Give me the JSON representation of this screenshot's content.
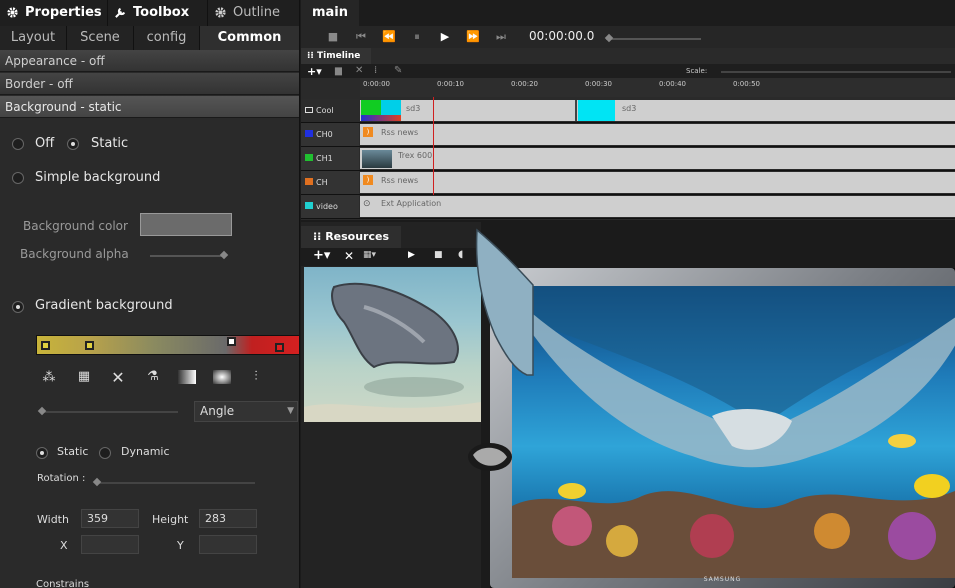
{
  "top_tabs": [
    {
      "label": "Properties",
      "icon": "gear-icon"
    },
    {
      "label": "Toolbox",
      "icon": "wrench-icon"
    },
    {
      "label": "Outline",
      "icon": "gear-icon"
    },
    {
      "label": "main"
    }
  ],
  "sub_tabs": [
    "Layout",
    "Scene",
    "config",
    "Common"
  ],
  "sections": [
    "Appearance - off",
    "Border - off",
    "Background - static"
  ],
  "background": {
    "off_label": "Off",
    "static_label": "Static",
    "simple_label": "Simple background",
    "color_label": "Background color",
    "alpha_label": "Background alpha",
    "gradient_label": "Gradient background",
    "gradient_type": "Angle",
    "mode_static": "Static",
    "mode_dynamic": "Dynamic",
    "rotation_label": "Rotation :",
    "width_label": "Width",
    "width_value": "359",
    "height_label": "Height",
    "height_value": "283",
    "x_label": "X",
    "y_label": "Y",
    "constraints_label": "Constrains"
  },
  "transport": {
    "time": "00:00:00.0"
  },
  "timeline": {
    "title": "Timeline",
    "scale_label": "Scale:",
    "ticks": [
      "0:00:00",
      "0:00:10",
      "0:00:20",
      "0:00:30",
      "0:00:40",
      "0:00:50"
    ],
    "rows": [
      {
        "name": "Cool",
        "clips": [
          "sd3",
          "sd3"
        ]
      },
      {
        "name": "CH0",
        "clips": [
          "Rss news"
        ]
      },
      {
        "name": "CH1",
        "clips": [
          "Trex 600"
        ]
      },
      {
        "name": "CH",
        "clips": [
          "Rss news"
        ]
      },
      {
        "name": "video",
        "clips": [
          "Ext Application"
        ]
      }
    ]
  },
  "resources": {
    "title": "Resources"
  },
  "tv": {
    "brand": "SAMSUNG"
  },
  "colors": {
    "accent": "#c8342a",
    "gradient_start": "#c8b43a",
    "gradient_end": "#d42020"
  }
}
